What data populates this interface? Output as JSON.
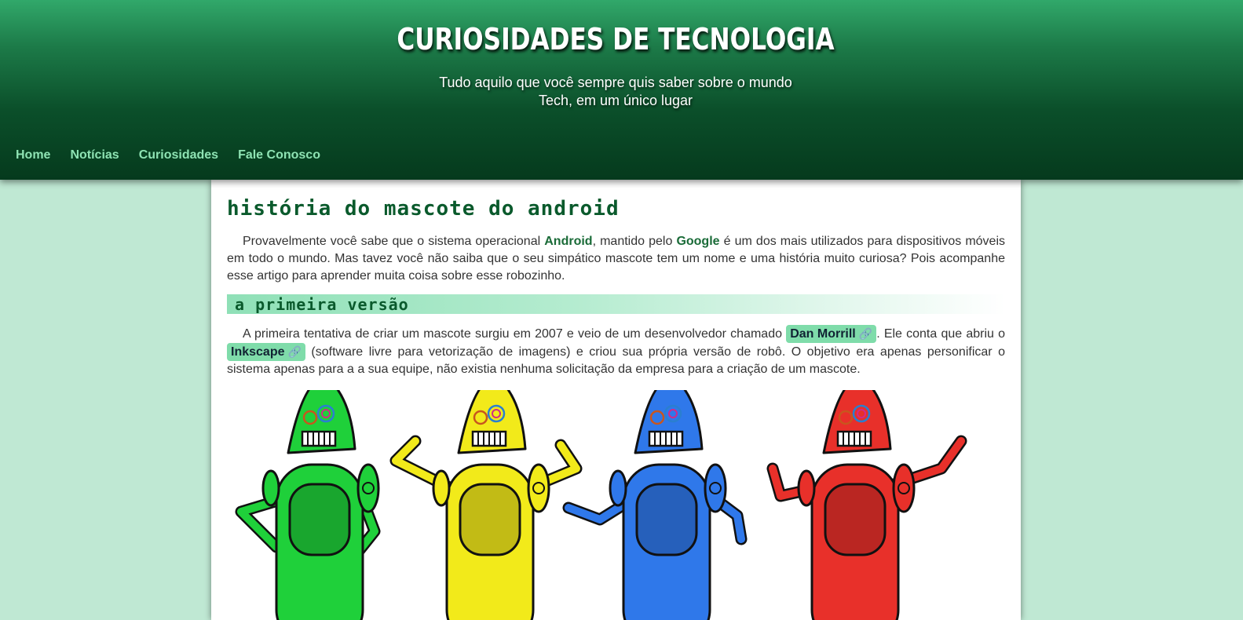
{
  "header": {
    "title": "CURIOSIDADES DE TECNOLOGIA",
    "subtitle_line1": "Tudo aquilo que você sempre quis saber sobre o mundo",
    "subtitle_line2": "Tech, em um único lugar"
  },
  "nav": {
    "items": [
      {
        "label": "Home"
      },
      {
        "label": "Notícias"
      },
      {
        "label": "Curiosidades"
      },
      {
        "label": "Fale Conosco"
      }
    ]
  },
  "article": {
    "title": "História do Mascote do Android",
    "intro": {
      "part1": "Provavelmente você sabe que o sistema operacional ",
      "android": "Android",
      "part2": ", mantido pelo ",
      "google": "Google",
      "part3": " é um dos mais utilizados para dispositivos móveis em todo o mundo. Mas tavez você não saiba que o seu simpático mascote tem um nome e uma história muito curiosa? Pois acompanhe esse artigo para aprender muita coisa sobre esse robozinho."
    },
    "section1": {
      "title": "A Primeira Versão",
      "part1": "A primeira tentativa de criar um mascote surgiu em 2007 e veio de um desenvolvedor chamado ",
      "link1": "Dan Morrill",
      "part2": ". Ele conta que abriu o ",
      "link2": "Inkscape",
      "part3": " (software livre para vetorização de imagens) e criou sua própria versão de robô. O objetivo era apenas personificar o sistema apenas para a a sua equipe, não existia nenhuma solicitação da empresa para a criação de um mascote."
    },
    "link_icon": "🔗",
    "robots": [
      {
        "color": "#1fd03a",
        "name": "green-robot"
      },
      {
        "color": "#f2ea1a",
        "name": "yellow-robot"
      },
      {
        "color": "#2f78ea",
        "name": "blue-robot"
      },
      {
        "color": "#e8302a",
        "name": "red-robot"
      }
    ]
  }
}
